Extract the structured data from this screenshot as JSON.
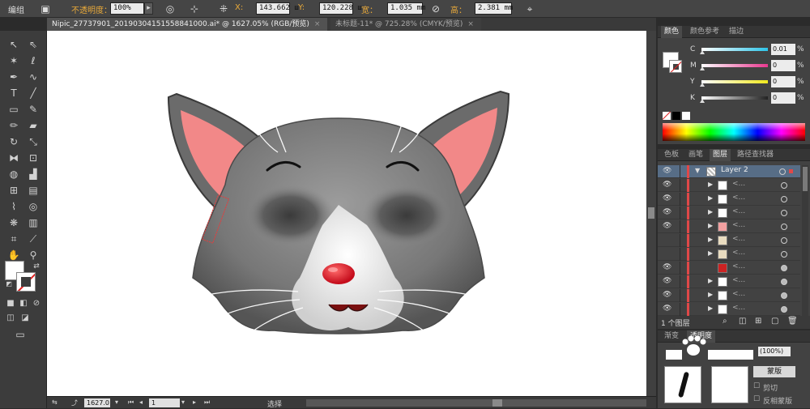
{
  "control_bar": {
    "group_label": "编组",
    "opacity_label": "不透明度：",
    "opacity_value": "100%",
    "x_label": "X:",
    "x_value": "143.662 ш",
    "y_label": "Y:",
    "y_value": "120.228 ш",
    "width_label": "宽：",
    "width_value": "1.035 mm",
    "height_label": "高：",
    "height_value": "2.381 mm"
  },
  "tabs": [
    {
      "label": "Nipic_27737901_20190304151558841000.ai* @ 1627.05% (RGB/预览)",
      "close": "×"
    },
    {
      "label": "未标题-11* @ 725.28% (CMYK/预览)",
      "close": "×"
    }
  ],
  "color_panel": {
    "tabs": [
      "颜色",
      "颜色参考",
      "描边"
    ],
    "sliders": [
      {
        "letter": "C",
        "value": "0.01",
        "pct": "%",
        "color": "#2ec4e8",
        "level": 0.0001
      },
      {
        "letter": "M",
        "value": "0",
        "pct": "%",
        "color": "#e8388f",
        "level": 0
      },
      {
        "letter": "Y",
        "value": "0",
        "pct": "%",
        "color": "#f0e81e",
        "level": 0
      },
      {
        "letter": "K",
        "value": "0",
        "pct": "%",
        "color": "#222222",
        "level": 0
      }
    ]
  },
  "layers_panel": {
    "tabs": [
      "色板",
      "画笔",
      "图层",
      "路径查找器"
    ],
    "top_layer": {
      "name": "Layer 2"
    },
    "rows": [
      {
        "name": "<...",
        "has_toggle": true,
        "visible": true
      },
      {
        "name": "<...",
        "has_toggle": true,
        "visible": true
      },
      {
        "name": "<...",
        "has_toggle": true,
        "visible": true
      },
      {
        "name": "<...",
        "has_toggle": true,
        "visible": true
      },
      {
        "name": "<...",
        "has_toggle": true,
        "visible": false
      },
      {
        "name": "<...",
        "has_toggle": true,
        "visible": false
      },
      {
        "name": "<...",
        "has_toggle": false,
        "visible": true
      },
      {
        "name": "<...",
        "has_toggle": true,
        "visible": true
      },
      {
        "name": "<...",
        "has_toggle": true,
        "visible": true
      },
      {
        "name": "<...",
        "has_toggle": true,
        "visible": true
      }
    ],
    "footer": "1 个图层"
  },
  "transparency_panel": {
    "tabs": [
      "渐变",
      "透明度"
    ],
    "opacity_value": "(100%)",
    "mask_label": "蒙版",
    "clip_label": "剪切",
    "invert_label": "反相蒙版"
  },
  "status_bar": {
    "zoom": "1627.0",
    "page": "1",
    "tool_label": "选择"
  },
  "colors": {
    "fill": "#ffffff",
    "ear_inner": "#f28888",
    "cat_fur": "#8a8a8a",
    "nose": "#e0182a"
  }
}
